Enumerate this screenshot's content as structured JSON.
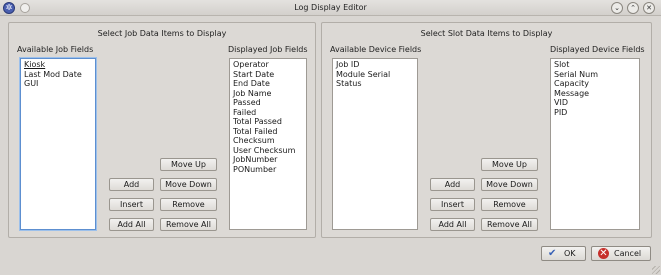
{
  "window": {
    "title": "Log Display Editor",
    "app_icon": "gear-icon",
    "controls": [
      "minimize-icon",
      "maximize-icon",
      "close-icon"
    ]
  },
  "job_panel": {
    "title": "Select Job Data Items to Display",
    "available_label": "Available Job Fields",
    "displayed_label": "Displayed Job Fields",
    "available_items": [
      "Kiosk",
      "Last Mod Date",
      "GUI"
    ],
    "displayed_items": [
      "Operator",
      "Start Date",
      "End Date",
      "Job Name",
      "Passed",
      "Failed",
      "Total Passed",
      "Total Failed",
      "Checksum",
      "User Checksum",
      "JobNumber",
      "PONumber"
    ],
    "buttons": {
      "move_up": "Move Up",
      "add": "Add",
      "move_down": "Move Down",
      "insert": "Insert",
      "remove": "Remove",
      "add_all": "Add All",
      "remove_all": "Remove All"
    }
  },
  "slot_panel": {
    "title": "Select Slot Data Items to Display",
    "available_label": "Available Device Fields",
    "displayed_label": "Displayed Device Fields",
    "available_items": [
      "Job ID",
      "Module Serial",
      "Status"
    ],
    "displayed_items": [
      "Slot",
      "Serial Num",
      "Capacity",
      "Message",
      "VID",
      "PID"
    ],
    "buttons": {
      "move_up": "Move Up",
      "add": "Add",
      "move_down": "Move Down",
      "insert": "Insert",
      "remove": "Remove",
      "add_all": "Add All",
      "remove_all": "Remove All"
    }
  },
  "footer": {
    "ok_label": "OK",
    "ok_icon": "checkmark-icon",
    "cancel_label": "Cancel",
    "cancel_icon": "cancel-icon"
  },
  "colors": {
    "focus_border": "#5d8fd0",
    "window_bg": "#d9d6d2"
  }
}
